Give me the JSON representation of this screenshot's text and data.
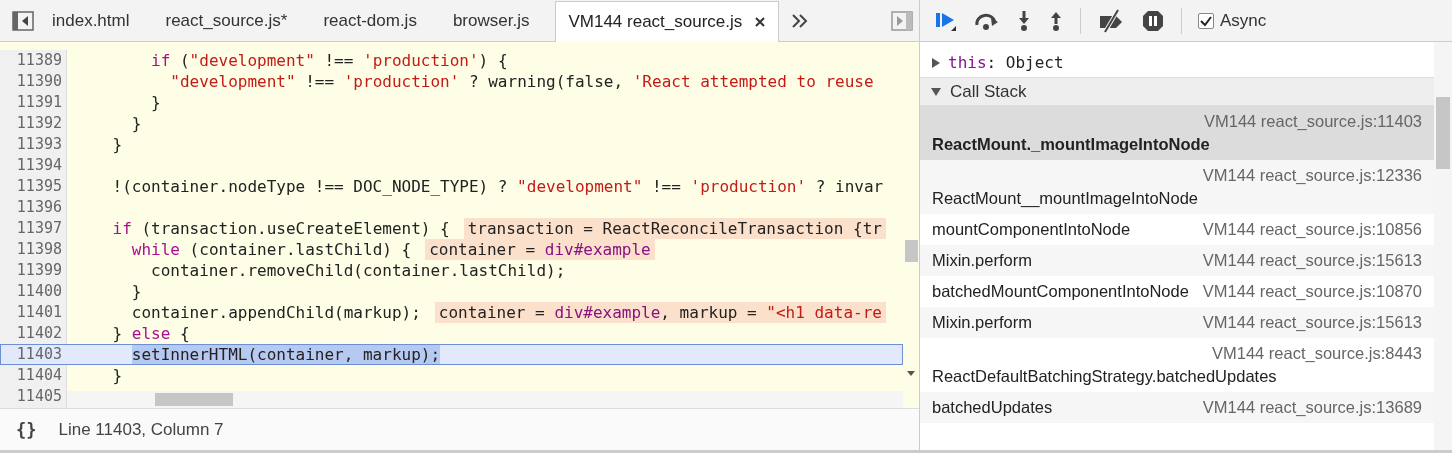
{
  "tabs": [
    {
      "label": "index.html",
      "selected": false,
      "closable": false
    },
    {
      "label": "react_source.js*",
      "selected": false,
      "closable": false
    },
    {
      "label": "react-dom.js",
      "selected": false,
      "closable": false
    },
    {
      "label": "browser.js",
      "selected": false,
      "closable": false
    },
    {
      "label": "VM144 react_source.js",
      "selected": true,
      "closable": true
    }
  ],
  "editor": {
    "lines": [
      {
        "number": "11389",
        "current": false,
        "tokens": [
          {
            "kind": "keyword",
            "text": "        if"
          },
          {
            "kind": "plain",
            "text": " ("
          },
          {
            "kind": "string",
            "text": "\"development\""
          },
          {
            "kind": "plain",
            "text": " !== "
          },
          {
            "kind": "string",
            "text": "'production'"
          },
          {
            "kind": "plain",
            "text": ") {"
          }
        ]
      },
      {
        "number": "11390",
        "current": false,
        "tokens": [
          {
            "kind": "string",
            "text": "          \"development\""
          },
          {
            "kind": "plain",
            "text": " !== "
          },
          {
            "kind": "string",
            "text": "'production'"
          },
          {
            "kind": "plain",
            "text": " ? warning(false, "
          },
          {
            "kind": "string",
            "text": "'React attempted to reuse"
          }
        ]
      },
      {
        "number": "11391",
        "current": false,
        "tokens": [
          {
            "kind": "plain",
            "text": "        }"
          }
        ]
      },
      {
        "number": "11392",
        "current": false,
        "tokens": [
          {
            "kind": "plain",
            "text": "      }"
          }
        ]
      },
      {
        "number": "11393",
        "current": false,
        "tokens": [
          {
            "kind": "plain",
            "text": "    }"
          }
        ]
      },
      {
        "number": "11394",
        "current": false
      },
      {
        "number": "11395",
        "current": false,
        "tokens": [
          {
            "kind": "plain",
            "text": "    !(container.nodeType !== DOC_NODE_TYPE) ? "
          },
          {
            "kind": "string",
            "text": "\"development\""
          },
          {
            "kind": "plain",
            "text": " !== "
          },
          {
            "kind": "string",
            "text": "'production'"
          },
          {
            "kind": "plain",
            "text": " ? invar"
          }
        ]
      },
      {
        "number": "11396",
        "current": false
      },
      {
        "number": "11397",
        "current": false,
        "tokens": [
          {
            "kind": "keyword",
            "text": "    if"
          },
          {
            "kind": "plain",
            "text": " (transaction.useCreateElement) {"
          }
        ],
        "inline_value": [
          {
            "kind": "plain",
            "text": "transaction = ReactReconcileTransaction {tr"
          }
        ]
      },
      {
        "number": "11398",
        "current": false,
        "tokens": [
          {
            "kind": "keyword",
            "text": "      while"
          },
          {
            "kind": "plain",
            "text": " (container.lastChild) {"
          }
        ],
        "inline_value": [
          {
            "kind": "plain",
            "text": "container = "
          },
          {
            "kind": "node",
            "text": "div#example"
          }
        ]
      },
      {
        "number": "11399",
        "current": false,
        "tokens": [
          {
            "kind": "plain",
            "text": "        container.removeChild(container.lastChild);"
          }
        ]
      },
      {
        "number": "11400",
        "current": false,
        "tokens": [
          {
            "kind": "plain",
            "text": "      }"
          }
        ]
      },
      {
        "number": "11401",
        "current": false,
        "tokens": [
          {
            "kind": "plain",
            "text": "      container.appendChild(markup);"
          }
        ],
        "inline_value": [
          {
            "kind": "plain",
            "text": "container = "
          },
          {
            "kind": "node",
            "text": "div#example"
          },
          {
            "kind": "plain",
            "text": ", markup = "
          },
          {
            "kind": "string",
            "text": "\"<h1 data-re"
          }
        ]
      },
      {
        "number": "11402",
        "current": false,
        "tokens": [
          {
            "kind": "plain",
            "text": "    } "
          },
          {
            "kind": "keyword",
            "text": "else"
          },
          {
            "kind": "plain",
            "text": " {"
          }
        ]
      },
      {
        "number": "11403",
        "current": true,
        "tokens": [
          {
            "kind": "selected",
            "text": "      setInnerHTML(container, markup);"
          }
        ]
      },
      {
        "number": "11404",
        "current": false,
        "tokens": [
          {
            "kind": "plain",
            "text": "    }"
          }
        ]
      },
      {
        "number": "11405",
        "current": false
      }
    ]
  },
  "status_bar": {
    "format_button": "{}",
    "position": "Line 11403, Column 7"
  },
  "debugger": {
    "async": {
      "label": "Async",
      "checked": true
    },
    "scope": [
      {
        "name": "this",
        "separator": ":",
        "value": "Object",
        "expanded": false
      }
    ],
    "call_stack": {
      "title": "Call Stack",
      "expanded": true,
      "frames": [
        {
          "function": "ReactMount._mountImageIntoNode",
          "location": "VM144 react_source.js:11403",
          "selected": true
        },
        {
          "function": "ReactMount__mountImageIntoNode",
          "location": "VM144 react_source.js:12336",
          "selected": false
        },
        {
          "function": "mountComponentIntoNode",
          "location": "VM144 react_source.js:10856",
          "selected": false
        },
        {
          "function": "Mixin.perform",
          "location": "VM144 react_source.js:15613",
          "selected": false
        },
        {
          "function": "batchedMountComponentIntoNode",
          "location": "VM144 react_source.js:10870",
          "selected": false
        },
        {
          "function": "Mixin.perform",
          "location": "VM144 react_source.js:15613",
          "selected": false
        },
        {
          "function": "ReactDefaultBatchingStrategy.batchedUpdates",
          "location": "VM144 react_source.js:8443",
          "selected": false
        },
        {
          "function": "batchedUpdates",
          "location": "VM144 react_source.js:13689",
          "selected": false
        }
      ]
    }
  }
}
